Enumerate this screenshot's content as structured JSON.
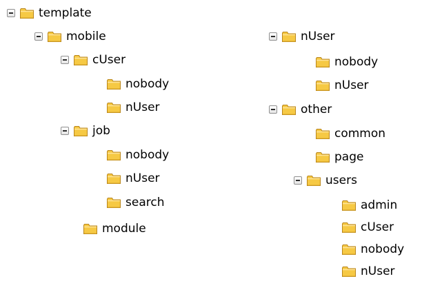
{
  "tree": {
    "nodes": [
      {
        "id": "template",
        "label": "template",
        "expanded": true,
        "icon": "folder-icon"
      },
      {
        "id": "mobile",
        "label": "mobile",
        "expanded": true,
        "icon": "folder-icon"
      },
      {
        "id": "mobile-cuser",
        "label": "cUser",
        "expanded": true,
        "icon": "folder-icon"
      },
      {
        "id": "mobile-cuser-nobody",
        "label": "nobody",
        "icon": "folder-icon"
      },
      {
        "id": "mobile-cuser-nuser",
        "label": "nUser",
        "icon": "folder-icon"
      },
      {
        "id": "mobile-job",
        "label": "job",
        "expanded": true,
        "icon": "folder-icon"
      },
      {
        "id": "mobile-job-nobody",
        "label": "nobody",
        "icon": "folder-icon"
      },
      {
        "id": "mobile-job-nuser",
        "label": "nUser",
        "icon": "folder-icon"
      },
      {
        "id": "mobile-job-search",
        "label": "search",
        "icon": "folder-icon"
      },
      {
        "id": "mobile-module",
        "label": "module",
        "icon": "folder-icon"
      },
      {
        "id": "nuser",
        "label": "nUser",
        "expanded": true,
        "icon": "folder-icon"
      },
      {
        "id": "nuser-nobody",
        "label": "nobody",
        "icon": "folder-icon"
      },
      {
        "id": "nuser-nuser",
        "label": "nUser",
        "icon": "folder-icon"
      },
      {
        "id": "other",
        "label": "other",
        "expanded": true,
        "icon": "folder-icon"
      },
      {
        "id": "other-common",
        "label": "common",
        "icon": "folder-icon"
      },
      {
        "id": "other-page",
        "label": "page",
        "icon": "folder-icon"
      },
      {
        "id": "other-users",
        "label": "users",
        "expanded": true,
        "icon": "folder-icon"
      },
      {
        "id": "other-users-admin",
        "label": "admin",
        "icon": "folder-icon"
      },
      {
        "id": "other-users-cuser",
        "label": "cUser",
        "icon": "folder-icon"
      },
      {
        "id": "other-users-nobody",
        "label": "nobody",
        "icon": "folder-icon"
      },
      {
        "id": "other-users-nuser",
        "label": "nUser",
        "icon": "folder-icon"
      }
    ]
  },
  "colors": {
    "folder_body": "#f6c944",
    "folder_outline": "#b9851a",
    "folder_highlight": "#ffe59a",
    "toggle_border": "#8f8f8f"
  }
}
